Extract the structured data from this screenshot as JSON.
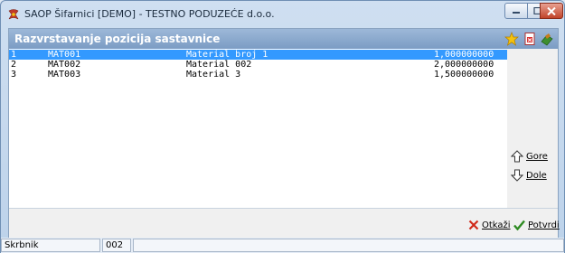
{
  "window": {
    "title": "SAOP Šifarnici [DEMO] - TESTNO PODUZEĆE d.o.o."
  },
  "panel": {
    "title": "Razvrstavanje pozicija sastavnice"
  },
  "rows": [
    {
      "num": "1",
      "code": "MAT001",
      "name": "Material broj 1",
      "qty": "1,000000000",
      "selected": true
    },
    {
      "num": "2",
      "code": "MAT002",
      "name": "Material 002",
      "qty": "2,000000000",
      "selected": false
    },
    {
      "num": "3",
      "code": "MAT003",
      "name": "Material 3",
      "qty": "1,500000000",
      "selected": false
    }
  ],
  "side": {
    "up_label": "Gore",
    "down_label": "Dole"
  },
  "footer": {
    "cancel_label": "Otkaži",
    "confirm_label": "Potvrdi"
  },
  "status": {
    "user": "Skrbnik",
    "code": "002"
  },
  "colors": {
    "selection": "#3399ff",
    "header": "#7b9cc4"
  }
}
